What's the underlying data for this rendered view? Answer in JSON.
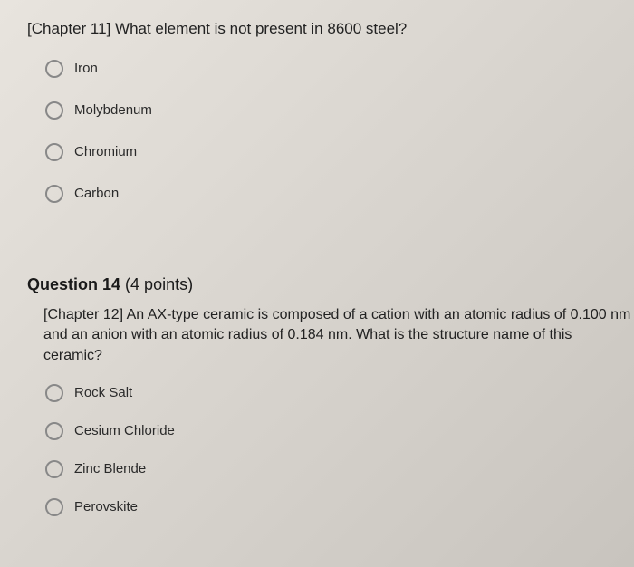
{
  "question1": {
    "text": "[Chapter 11] What element is not present in 8600 steel?",
    "options": [
      "Iron",
      "Molybdenum",
      "Chromium",
      "Carbon"
    ]
  },
  "question2": {
    "header_number": "Question 14",
    "header_points": "(4 points)",
    "text": "[Chapter 12] An AX-type ceramic is composed of a cation with an atomic radius of 0.100 nm and an anion with an atomic radius of 0.184 nm. What is the structure name of this ceramic?",
    "options": [
      "Rock Salt",
      "Cesium Chloride",
      "Zinc Blende",
      "Perovskite"
    ]
  }
}
